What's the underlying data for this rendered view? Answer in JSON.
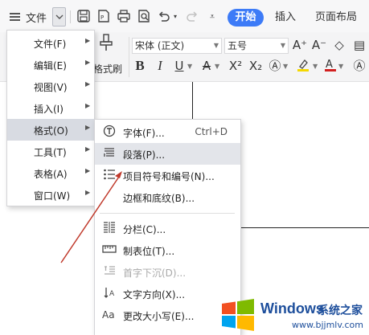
{
  "toolbar": {
    "file_menu_label": "文件",
    "active_tab": "开始",
    "tabs": [
      "插入",
      "页面布局"
    ]
  },
  "ribbon": {
    "format_painter_label": "格式刷",
    "font_name": "宋体 (正文)",
    "font_size": "五号"
  },
  "file_menu": {
    "items": [
      {
        "label": "文件(F)"
      },
      {
        "label": "编辑(E)"
      },
      {
        "label": "视图(V)"
      },
      {
        "label": "插入(I)"
      },
      {
        "label": "格式(O)"
      },
      {
        "label": "工具(T)"
      },
      {
        "label": "表格(A)"
      },
      {
        "label": "窗口(W)"
      }
    ]
  },
  "format_menu": {
    "items": [
      {
        "label": "字体(F)...",
        "shortcut": "Ctrl+D"
      },
      {
        "label": "段落(P)..."
      },
      {
        "label": "项目符号和编号(N)..."
      },
      {
        "label": "边框和底纹(B)..."
      },
      {
        "label": "分栏(C)..."
      },
      {
        "label": "制表位(T)..."
      },
      {
        "label": "首字下沉(D)..."
      },
      {
        "label": "文字方向(X)..."
      },
      {
        "label": "更改大小写(E)..."
      }
    ]
  },
  "watermark": {
    "title": "Windows",
    "brand": "系统之家",
    "url": "www.bjjmlv.com"
  },
  "colors": {
    "accent": "#3d7bf7",
    "arrow": "#c0392b",
    "menu_hover": "#d8dbe2",
    "watermark": "#1e4f9c"
  }
}
